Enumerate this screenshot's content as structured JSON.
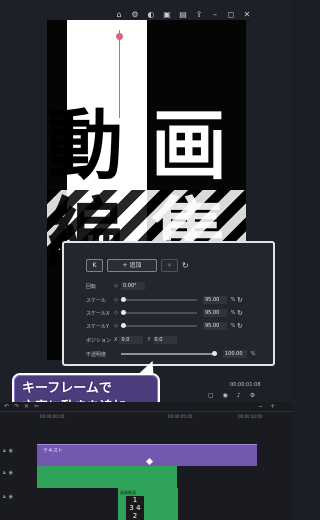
{
  "topbar": {
    "icons": [
      "home-icon",
      "gear-icon",
      "bulb-icon",
      "save-icon",
      "folder-icon",
      "upload-icon",
      "minimize-icon",
      "maximize-icon",
      "close-icon"
    ]
  },
  "preview": {
    "char1": "動",
    "char2": "画",
    "char3": "編",
    "char4": "集"
  },
  "keyframe_panel": {
    "prev_label": "K",
    "add_label": "+ 追加",
    "delete_label": "×",
    "rotation_label": "回転",
    "rotation_value": "0.00°",
    "scale_label": "スケール",
    "scale_value": "95.00",
    "scale_x_label": "スケールX",
    "scale_x_value": "95.00",
    "scale_y_label": "スケールY",
    "scale_y_value": "95.00",
    "percent": "%",
    "position_label": "ポジション",
    "x_label": "X",
    "x_value": "0.0",
    "y_label": "Y",
    "y_value": "0.0",
    "opacity_label": "不透明度",
    "opacity_value": "100.00"
  },
  "caption": {
    "line1": "キーフレームで",
    "line2": "文字に動きを追加"
  },
  "controls": {
    "timecode": "00:00:01:08"
  },
  "timeline": {
    "ruler": [
      "00:00:00:00",
      "00:00:05:00",
      "00:00:10:00"
    ],
    "text_clip_label": "テキスト",
    "video_clip_label": "画像動画"
  },
  "numbers_box": {
    "line1": "1",
    "line2": "3 4",
    "line3": "2"
  }
}
